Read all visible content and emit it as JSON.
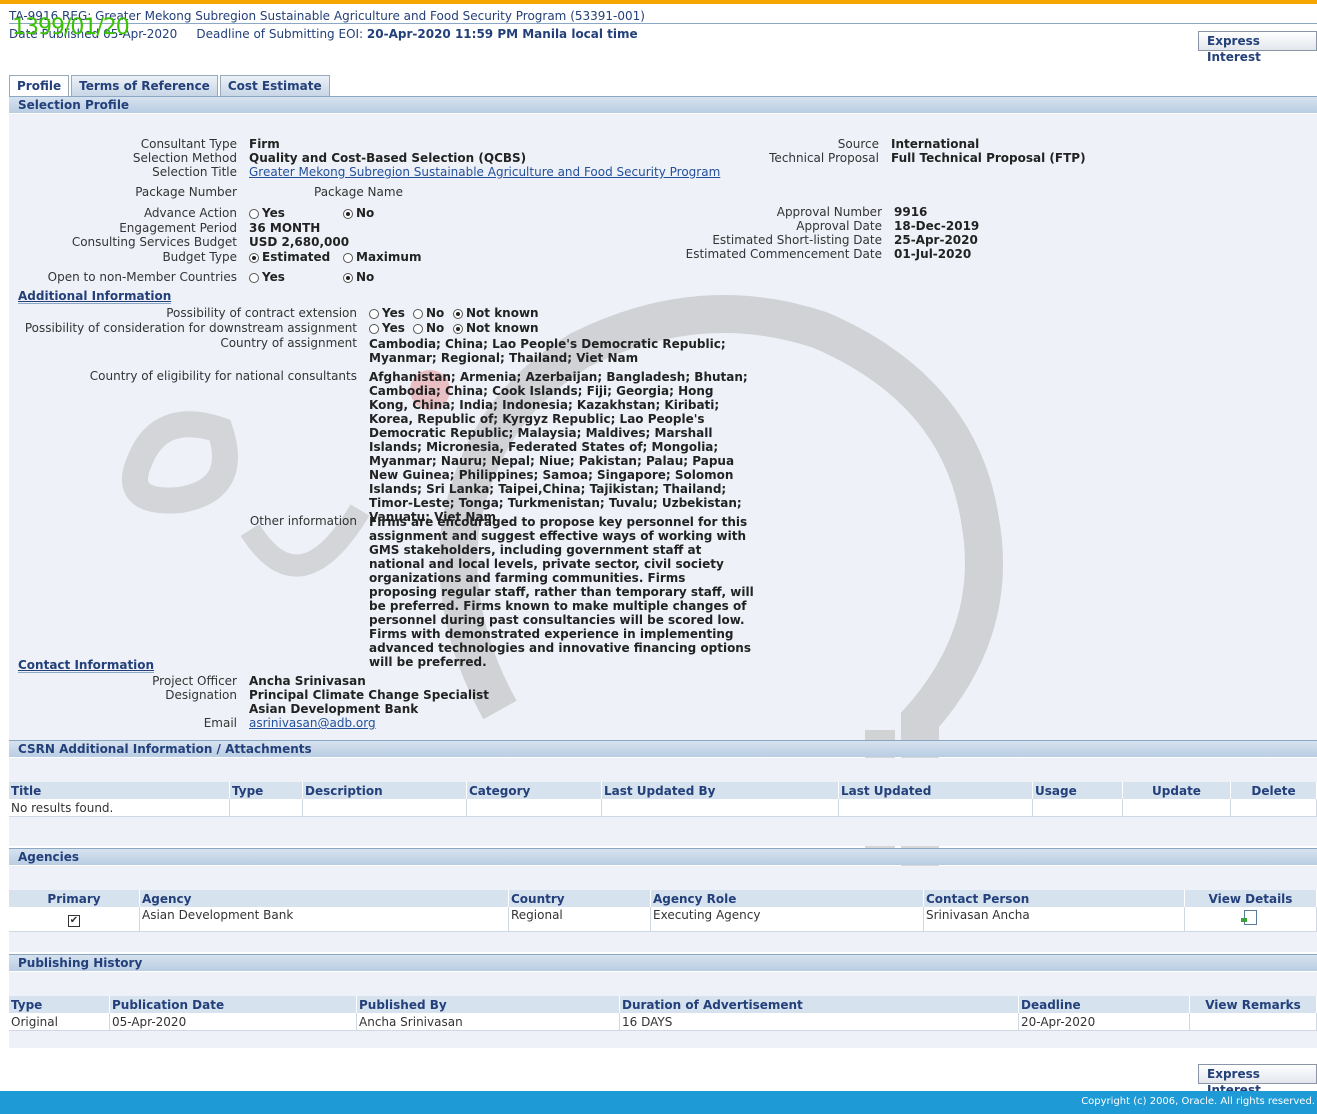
{
  "header": {
    "title": "TA-9916 REG: Greater Mekong Subregion Sustainable Agriculture and Food Security Program (53391-001)",
    "date_published_label": "Date Published",
    "date_published": "05-Apr-2020",
    "deadline_label": "Deadline of Submitting EOI:",
    "deadline_value": "20-Apr-2020 11:59 PM Manila local time",
    "stamp": "1399/01/20",
    "express_interest": "Express Interest"
  },
  "tabs": [
    "Profile",
    "Terms of Reference",
    "Cost Estimate"
  ],
  "selection_profile": {
    "section_title": "Selection Profile",
    "consultant_type_label": "Consultant Type",
    "consultant_type": "Firm",
    "selection_method_label": "Selection Method",
    "selection_method": "Quality and Cost-Based Selection (QCBS)",
    "selection_title_label": "Selection Title",
    "selection_title": "Greater Mekong Subregion Sustainable Agriculture and Food Security Program",
    "package_number_label": "Package Number",
    "package_name_label": "Package Name",
    "advance_action_label": "Advance Action",
    "yes": "Yes",
    "no": "No",
    "engagement_period_label": "Engagement Period",
    "engagement_period": "36 MONTH",
    "budget_label": "Consulting Services Budget",
    "budget": "USD 2,680,000",
    "budget_type_label": "Budget Type",
    "estimated": "Estimated",
    "maximum": "Maximum",
    "open_label": "Open to non-Member Countries",
    "source_label": "Source",
    "source": "International",
    "technical_proposal_label": "Technical Proposal",
    "technical_proposal": "Full Technical Proposal (FTP)",
    "approval_number_label": "Approval Number",
    "approval_number": "9916",
    "approval_date_label": "Approval Date",
    "approval_date": "18-Dec-2019",
    "shortlisting_label": "Estimated Short-listing Date",
    "shortlisting_date": "25-Apr-2020",
    "commencement_label": "Estimated Commencement Date",
    "commencement_date": "01-Jul-2020"
  },
  "additional": {
    "heading": "Additional Information",
    "extension_label": "Possibility of contract extension",
    "downstream_label": "Possibility of consideration for downstream assignment",
    "not_known": "Not known",
    "country_assignment_label": "Country of assignment",
    "country_assignment": "Cambodia; China; Lao People's Democratic Republic; Myanmar; Regional; Thailand; Viet Nam",
    "eligibility_label": "Country of eligibility for national consultants",
    "eligibility": "Afghanistan; Armenia; Azerbaijan; Bangladesh; Bhutan; Cambodia; China; Cook Islands; Fiji; Georgia; Hong Kong, China; India; Indonesia; Kazakhstan; Kiribati; Korea, Republic of; Kyrgyz Republic; Lao People's Democratic Republic; Malaysia; Maldives; Marshall Islands; Micronesia, Federated States of; Mongolia; Myanmar; Nauru; Nepal; Niue; Pakistan; Palau; Papua New Guinea; Philippines; Samoa; Singapore; Solomon Islands; Sri Lanka; Taipei,China; Tajikistan; Thailand; Timor-Leste; Tonga; Turkmenistan; Tuvalu; Uzbekistan; Vanuatu; Viet Nam",
    "other_label": "Other information",
    "other": "Firms are encouraged to propose key personnel for this assignment and suggest effective ways of working with GMS stakeholders, including government staff at national and local levels, private sector, civil society organizations and farming communities. Firms proposing regular staff, rather than temporary staff, will be preferred. Firms known to make multiple changes of personnel during past consultancies will be scored low. Firms with demonstrated experience in implementing advanced technologies and innovative financing options will be preferred."
  },
  "contact": {
    "heading": "Contact Information",
    "officer_label": "Project Officer",
    "officer": "Ancha Srinivasan",
    "designation_label": "Designation",
    "designation": "Principal Climate Change Specialist",
    "organization": "Asian Development Bank",
    "email_label": "Email",
    "email": "asrinivasan@adb.org"
  },
  "csrn": {
    "section_title": "CSRN Additional Information / Attachments",
    "columns": [
      "Title",
      "Type",
      "Description",
      "Category",
      "Last Updated By",
      "Last Updated",
      "Usage",
      "Update",
      "Delete"
    ],
    "empty": "No results found."
  },
  "agencies": {
    "section_title": "Agencies",
    "columns": [
      "Primary",
      "Agency",
      "Country",
      "Agency Role",
      "Contact Person",
      "View Details"
    ],
    "rows": [
      {
        "primary": "✔",
        "agency": "Asian Development Bank",
        "country": "Regional",
        "role": "Executing Agency",
        "contact": "Srinivasan Ancha"
      }
    ]
  },
  "publishing": {
    "section_title": "Publishing History",
    "columns": [
      "Type",
      "Publication Date",
      "Published By",
      "Duration of Advertisement",
      "Deadline",
      "View Remarks"
    ],
    "rows": [
      {
        "type": "Original",
        "date": "05-Apr-2020",
        "by": "Ancha Srinivasan",
        "duration": "16 DAYS",
        "deadline": "20-Apr-2020",
        "remarks": ""
      }
    ]
  },
  "footer": {
    "copyright": "Copyright (c) 2006, Oracle. All rights reserved."
  }
}
